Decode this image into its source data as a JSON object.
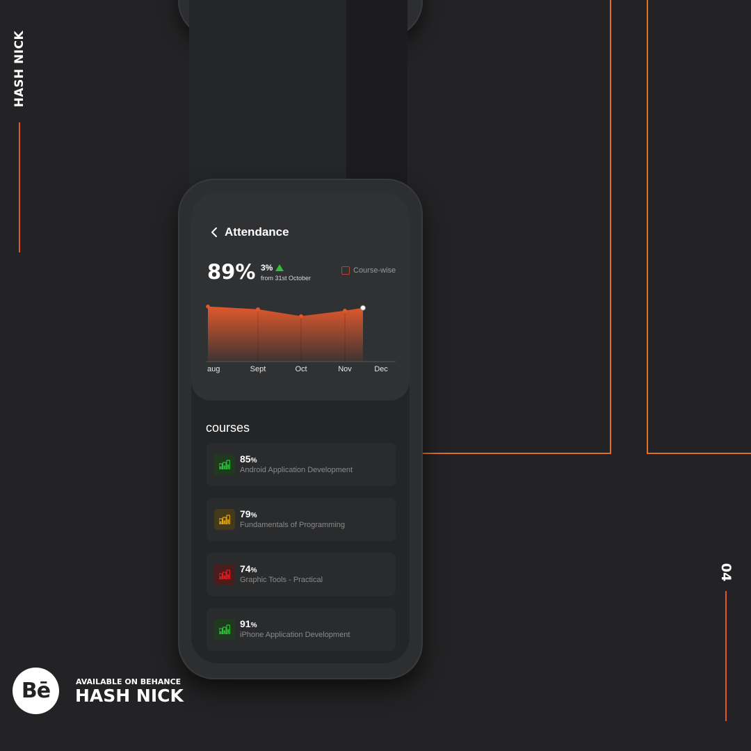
{
  "branding": {
    "side_name": "HASH NICK",
    "page_number": "04",
    "available_label": "AVAILABLE ON BEHANCE",
    "brand_name": "HASH NICK",
    "logo_text": "Bē"
  },
  "colors": {
    "accent": "#e0582c",
    "background": "#232325",
    "up": "#2fbf3a",
    "green": "#2fbf3a",
    "yellow": "#e6a600",
    "red": "#e02020"
  },
  "header": {
    "title": "Attendance",
    "back_icon": "chevron-left-icon"
  },
  "summary": {
    "percentage": "89%",
    "change_value": "3%",
    "change_direction": "up",
    "change_note": "from 31st October",
    "toggle_label": "Course-wise",
    "toggle_checked": false
  },
  "chart_data": {
    "type": "area",
    "categories": [
      "aug",
      "Sept",
      "Oct",
      "Nov",
      "Dec"
    ],
    "series": [
      {
        "values": [
          90,
          88,
          83,
          87,
          89
        ]
      }
    ],
    "ylim": [
      50,
      100
    ],
    "legend": "none",
    "grid": false
  },
  "courses": {
    "title": "courses",
    "items": [
      {
        "percent": "85",
        "unit": "%",
        "name": "Android Application Development",
        "status": "green"
      },
      {
        "percent": "79",
        "unit": "%",
        "name": "Fundamentals of Programming",
        "status": "yellow"
      },
      {
        "percent": "74",
        "unit": "%",
        "name": "Graphic Tools - Practical",
        "status": "red"
      },
      {
        "percent": "91",
        "unit": "%",
        "name": "iPhone Application Development",
        "status": "green"
      }
    ]
  }
}
